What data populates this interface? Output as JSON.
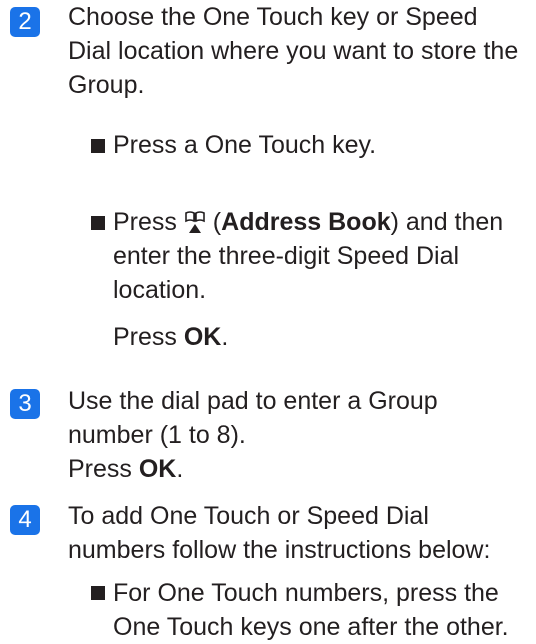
{
  "colors": {
    "step_badge": "#1a73e8",
    "text": "#231f20"
  },
  "step2": {
    "number": "2",
    "lines": [
      "Choose the One Touch key or Speed",
      "Dial location where you want to store the",
      "Group."
    ],
    "bullet1": "Press a One Touch key.",
    "bullet2_prefix": "Press ",
    "bullet2_icon": "address-book-icon",
    "bullet2_open": " (",
    "bullet2_bold": "Address Book",
    "bullet2_rest": ") and then",
    "bullet2_line2": "enter the three-digit Speed Dial",
    "bullet2_line3": "location.",
    "press_prefix": "Press ",
    "press_bold": "OK",
    "press_suffix": "."
  },
  "step3": {
    "number": "3",
    "line1": "Use the dial pad to enter a Group",
    "line2": "number (1 to 8).",
    "press_prefix": "Press ",
    "press_bold": "OK",
    "press_suffix": "."
  },
  "step4": {
    "number": "4",
    "line1": "To add One Touch or Speed Dial",
    "line2": "numbers follow the instructions below:",
    "bullet1_line1": "For One Touch numbers, press the",
    "bullet1_line2": "One Touch keys one after the other."
  }
}
